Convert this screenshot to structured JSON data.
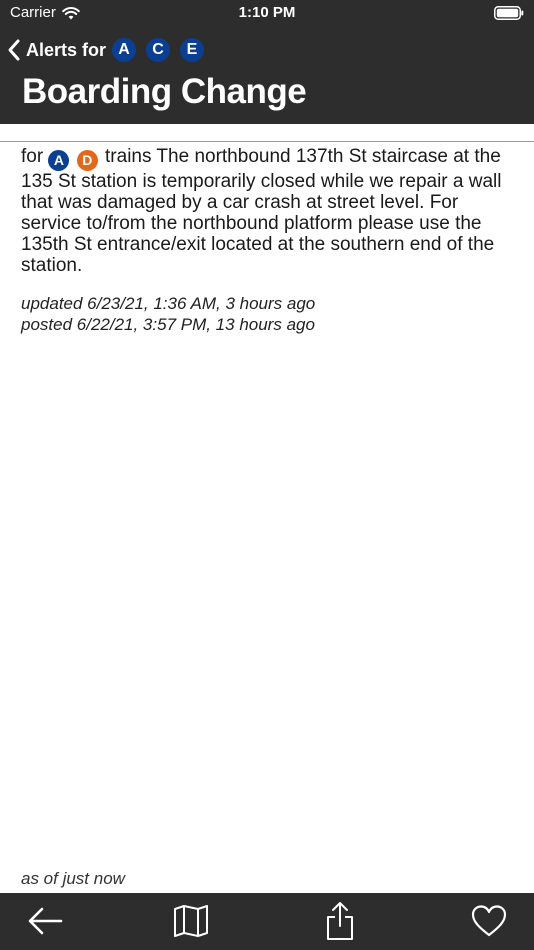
{
  "status_bar": {
    "carrier": "Carrier",
    "time": "1:10 PM"
  },
  "nav": {
    "back_label": "Alerts for",
    "routes": [
      {
        "letter": "A",
        "color": "#0b3f91"
      },
      {
        "letter": "C",
        "color": "#0b3f91"
      },
      {
        "letter": "E",
        "color": "#0b3f91"
      }
    ]
  },
  "title": "Boarding Change",
  "alert": {
    "prefix": "for",
    "routes": [
      {
        "letter": "A",
        "color": "#0b3f91"
      },
      {
        "letter": "D",
        "color": "#e2691c"
      }
    ],
    "text": "trains The northbound 137th St staircase at the 135 St station is temporarily closed while we repair a wall that was damaged by a car crash at street level. For service to/from the northbound platform please use the 135th St entrance/exit located at the southern end of the station.",
    "updated": "updated 6/23/21, 1:36 AM, 3 hours ago",
    "posted": "posted 6/22/21, 3:57 PM, 13 hours ago"
  },
  "as_of": "as of just now",
  "toolbar": {
    "icons": [
      "back-arrow-icon",
      "map-icon",
      "share-icon",
      "heart-icon"
    ]
  },
  "colors": {
    "bar_background": "#2d2d2d",
    "route_blue": "#0b3f91",
    "route_orange": "#e2691c"
  }
}
